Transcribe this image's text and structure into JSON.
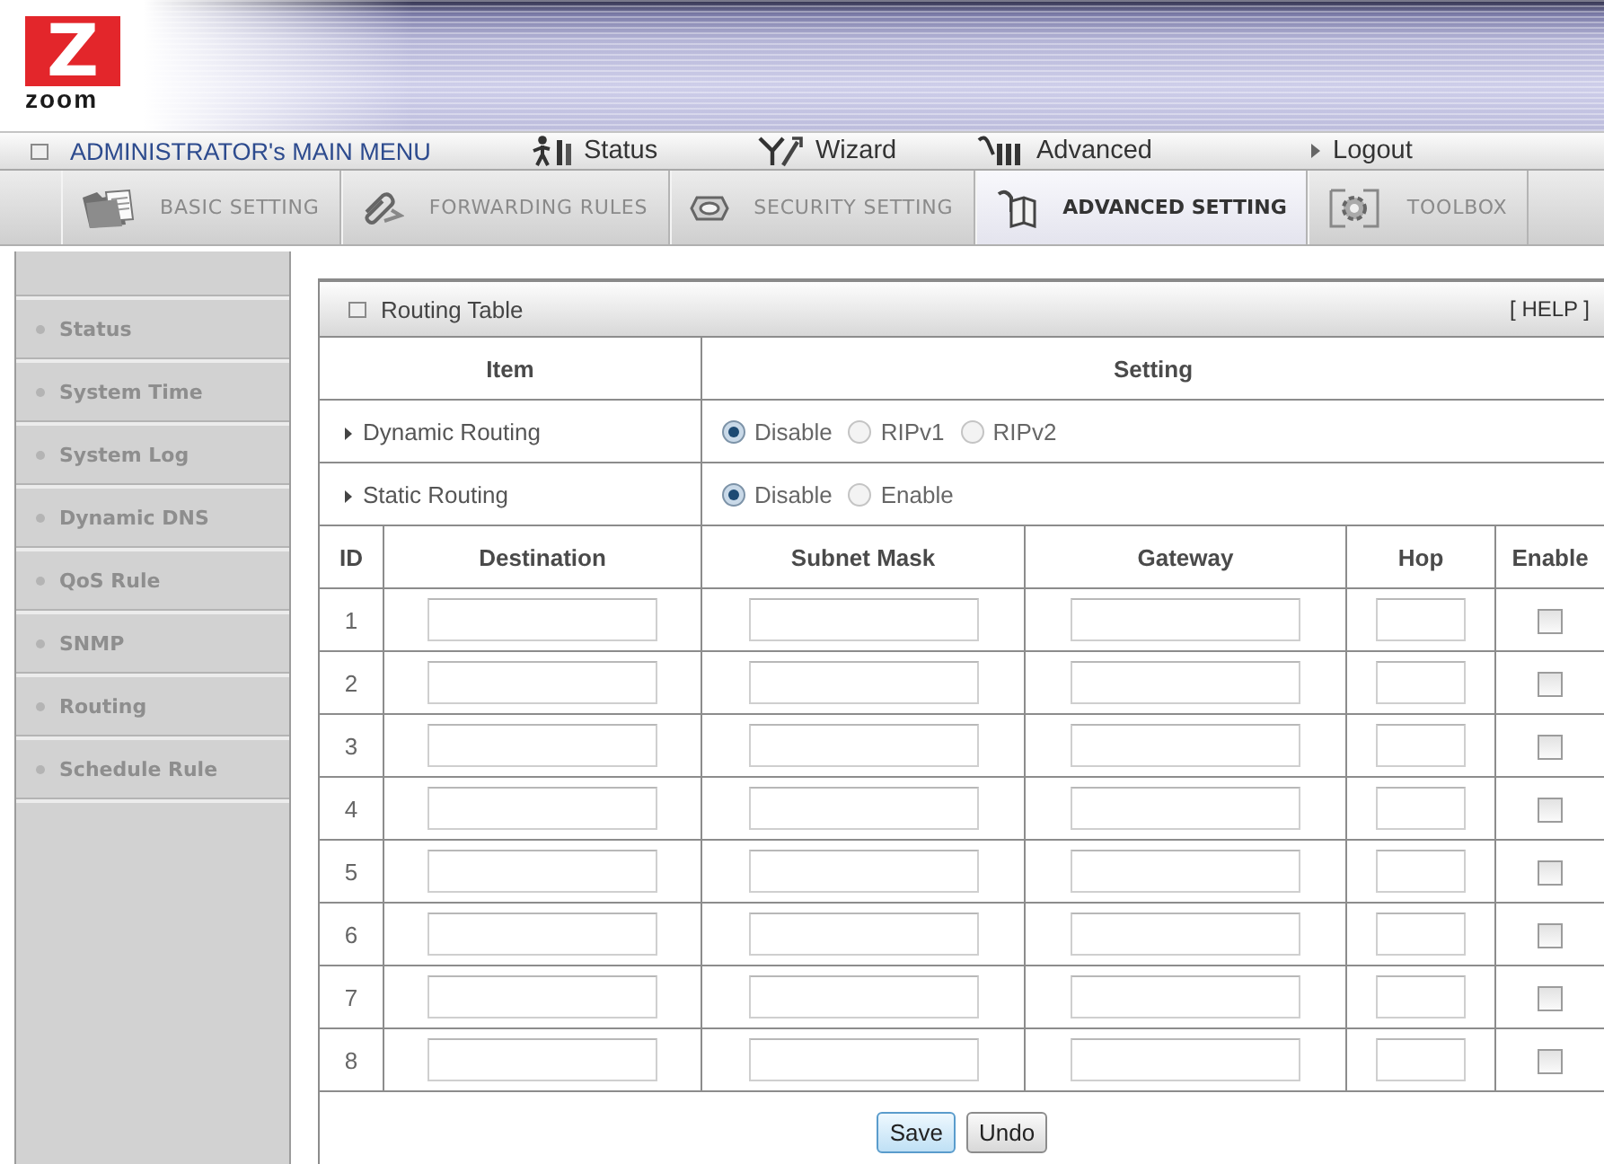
{
  "header": {
    "logo": {
      "mark": "Z",
      "wordmark": "zoom"
    }
  },
  "main_menu": {
    "title": "ADMINISTRATOR's MAIN MENU",
    "items": [
      {
        "label": "Status",
        "kind": "status"
      },
      {
        "label": "Wizard",
        "kind": "wizard"
      },
      {
        "label": "Advanced",
        "kind": "advanced"
      },
      {
        "label": "Logout",
        "kind": "logout"
      }
    ]
  },
  "tabs": [
    {
      "label": "BASIC SETTING",
      "kind": "basic",
      "selected": false
    },
    {
      "label": "FORWARDING RULES",
      "kind": "forwarding",
      "selected": false
    },
    {
      "label": "SECURITY SETTING",
      "kind": "security",
      "selected": false
    },
    {
      "label": "ADVANCED SETTING",
      "kind": "advanced",
      "selected": true
    },
    {
      "label": "TOOLBOX",
      "kind": "toolbox",
      "selected": false
    }
  ],
  "sidebar": {
    "items": [
      "Status",
      "System Time",
      "System Log",
      "Dynamic DNS",
      "QoS Rule",
      "SNMP",
      "Routing",
      "Schedule Rule"
    ]
  },
  "panel": {
    "title": "Routing Table",
    "help": "[ HELP ]",
    "columns": [
      "Item",
      "Setting"
    ],
    "settings": [
      {
        "label": "Dynamic Routing",
        "options": [
          {
            "label": "Disable",
            "selected": true
          },
          {
            "label": "RIPv1",
            "selected": false
          },
          {
            "label": "RIPv2",
            "selected": false
          }
        ]
      },
      {
        "label": "Static Routing",
        "options": [
          {
            "label": "Disable",
            "selected": true
          },
          {
            "label": "Enable",
            "selected": false
          }
        ]
      }
    ],
    "routes": {
      "columns": [
        {
          "label": "ID",
          "kind": "id"
        },
        {
          "label": "Destination",
          "kind": "text"
        },
        {
          "label": "Subnet Mask",
          "kind": "text"
        },
        {
          "label": "Gateway",
          "kind": "text"
        },
        {
          "label": "Hop",
          "kind": "short"
        },
        {
          "label": "Enable",
          "kind": "check"
        }
      ],
      "rows": [
        {
          "id": "1",
          "enabled": false
        },
        {
          "id": "2",
          "enabled": false
        },
        {
          "id": "3",
          "enabled": false
        },
        {
          "id": "4",
          "enabled": false
        },
        {
          "id": "5",
          "enabled": false
        },
        {
          "id": "6",
          "enabled": false
        },
        {
          "id": "7",
          "enabled": false
        },
        {
          "id": "8",
          "enabled": false
        }
      ]
    },
    "buttons": [
      {
        "label": "Save",
        "focused": true
      },
      {
        "label": "Undo",
        "focused": false
      }
    ]
  }
}
